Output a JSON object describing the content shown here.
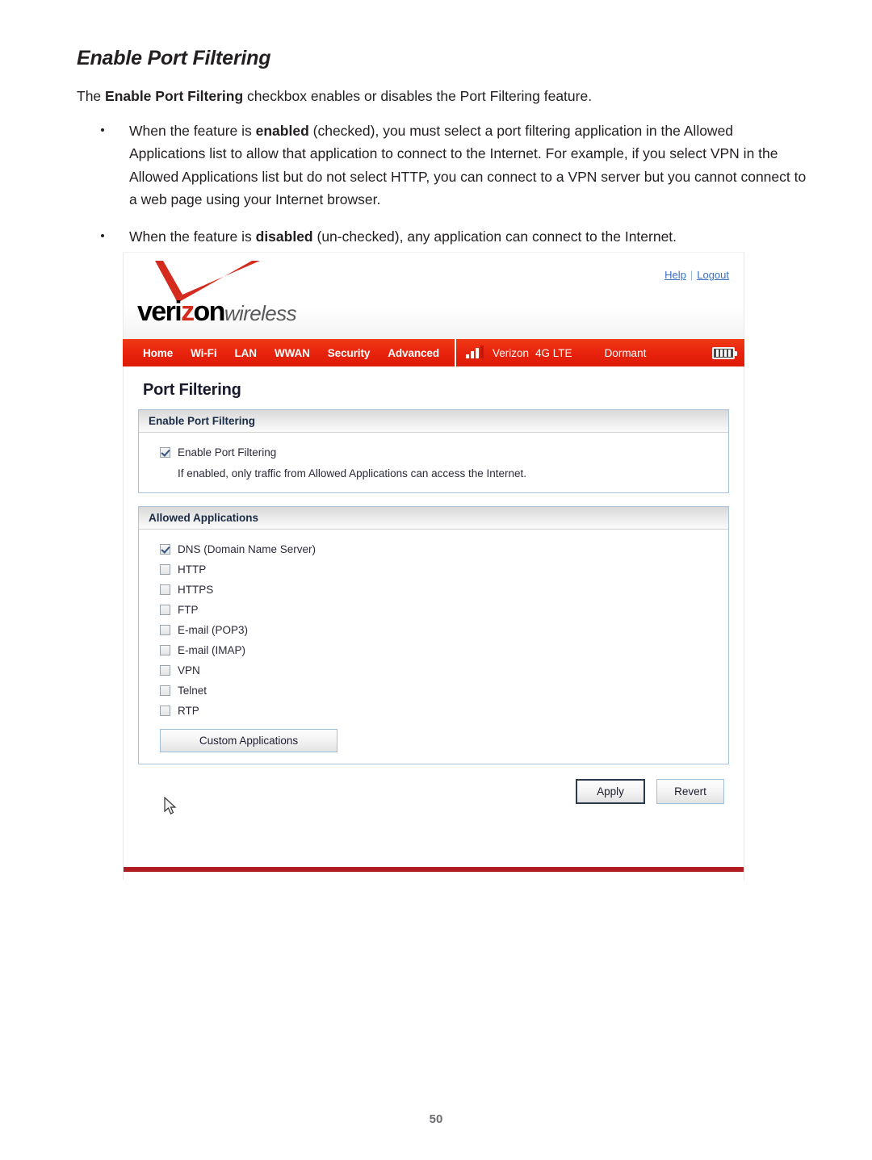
{
  "document": {
    "title": "Enable Port Filtering",
    "intro_prefix": "The ",
    "intro_bold": "Enable Port Filtering",
    "intro_suffix": " checkbox enables or disables the Port Filtering feature.",
    "bullets": [
      {
        "part1": "When the feature is ",
        "bold": "enabled",
        "part2": " (checked), you must select a port filtering application in the Allowed Applications list to allow that application to connect to the Internet. For example, if you select VPN in the Allowed Applications list but do not select HTTP, you can connect to a VPN server but you cannot connect to a web page using your Internet browser."
      },
      {
        "part1": "When the feature is ",
        "bold": "disabled",
        "part2": " (un-checked), any application can connect to the Internet."
      }
    ],
    "page_number": "50"
  },
  "screenshot": {
    "brand": {
      "word_veri": "veri",
      "word_z": "z",
      "word_on": "on",
      "word_wireless": "wireless"
    },
    "toplinks": {
      "help": "Help",
      "separator": "|",
      "logout": "Logout"
    },
    "nav": {
      "items": [
        {
          "label": "Home"
        },
        {
          "label": "Wi-Fi"
        },
        {
          "label": "LAN"
        },
        {
          "label": "WWAN"
        },
        {
          "label": "Security"
        },
        {
          "label": "Advanced"
        }
      ]
    },
    "status": {
      "carrier": "Verizon",
      "technology": "4G LTE",
      "connection_state": "Dormant",
      "signal_bars": "3",
      "battery_bars": "4"
    },
    "page_heading": "Port Filtering",
    "panels": [
      {
        "heading": "Enable Port Filtering",
        "checkbox_label": "Enable Port Filtering",
        "checkbox_checked": true,
        "hint": "If enabled, only traffic from Allowed Applications can access the Internet."
      },
      {
        "heading": "Allowed Applications",
        "items": [
          {
            "label": "DNS (Domain Name Server)",
            "checked": true
          },
          {
            "label": "HTTP",
            "checked": false
          },
          {
            "label": "HTTPS",
            "checked": false
          },
          {
            "label": "FTP",
            "checked": false
          },
          {
            "label": "E-mail (POP3)",
            "checked": false
          },
          {
            "label": "E-mail (IMAP)",
            "checked": false
          },
          {
            "label": "VPN",
            "checked": false
          },
          {
            "label": "Telnet",
            "checked": false
          },
          {
            "label": "RTP",
            "checked": false
          }
        ],
        "custom_button": "Custom Applications"
      }
    ],
    "actions": {
      "apply": "Apply",
      "revert": "Revert"
    },
    "colors": {
      "brand_red": "#e8230d",
      "logo_red": "#d52b1e",
      "link_blue": "#3a6fc4",
      "footer_red": "#b01c20",
      "panel_border": "#a8c4dc"
    }
  }
}
